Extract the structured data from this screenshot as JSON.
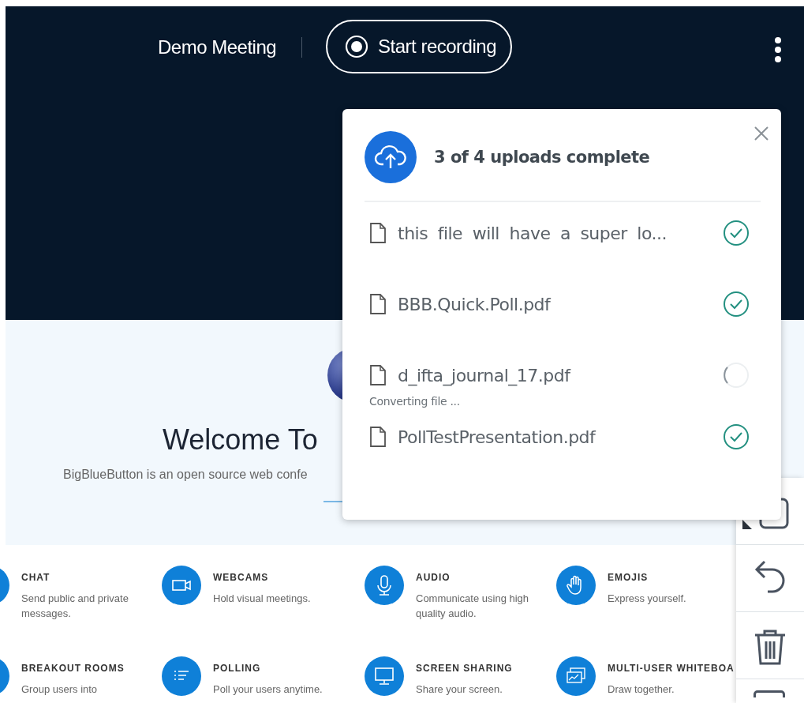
{
  "header": {
    "title": "Demo Meeting",
    "record_button": {
      "label": "Start recording"
    }
  },
  "welcome": {
    "title": "Welcome To",
    "subtitle": "BigBlueButton is an open source web confe"
  },
  "features": [
    {
      "kind": "chat",
      "title": "CHAT",
      "description": "Send public and private messages."
    },
    {
      "kind": "webcams",
      "title": "WEBCAMS",
      "description": "Hold visual meetings."
    },
    {
      "kind": "audio",
      "title": "AUDIO",
      "description": "Communicate using high quality audio."
    },
    {
      "kind": "emojis",
      "title": "EMOJIS",
      "description": "Express yourself."
    },
    {
      "kind": "breakout",
      "title": "BREAKOUT ROOMS",
      "description": "Group users into"
    },
    {
      "kind": "polling",
      "title": "POLLING",
      "description": "Poll your users anytime."
    },
    {
      "kind": "screen",
      "title": "SCREEN SHARING",
      "description": "Share your screen."
    },
    {
      "kind": "whiteboard",
      "title": "MULTI-USER WHITEBOA",
      "description": "Draw together."
    }
  ],
  "toolbar": {
    "tools": [
      {
        "kind": "shape"
      },
      {
        "kind": "undo"
      },
      {
        "kind": "trash"
      },
      {
        "kind": "board"
      }
    ]
  },
  "upload_toast": {
    "title": "3 of 4 uploads complete",
    "files": [
      {
        "name": "this file will have a super lo...",
        "complete": true
      },
      {
        "name": "BBB.Quick.Poll.pdf",
        "complete": true
      },
      {
        "name": "d_ifta_journal_17.pdf",
        "complete": false,
        "status_text": "Converting file ..."
      },
      {
        "name": "PollTestPresentation.pdf",
        "complete": true
      }
    ]
  }
}
